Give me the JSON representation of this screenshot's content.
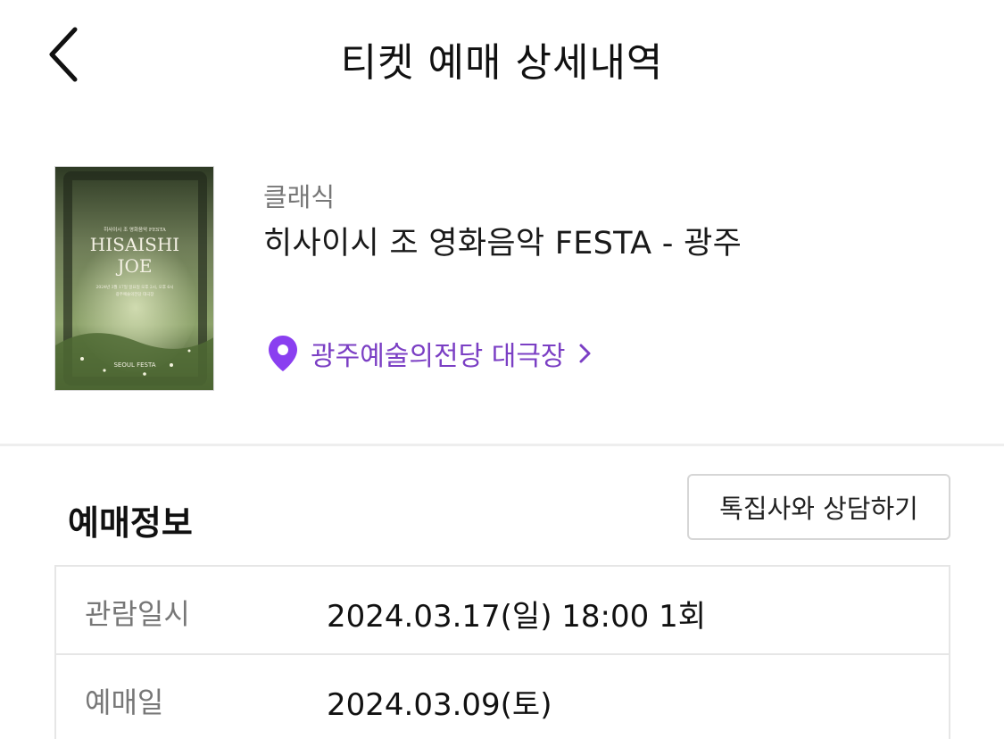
{
  "header": {
    "title": "티켓 예매 상세내역",
    "back_icon": "chevron-left-icon"
  },
  "event": {
    "poster": {
      "small_text": "히사이시 조 영화음악 FESTA",
      "name_line1": "HISAISHI",
      "name_line2": "JOE",
      "detail_line1": "2024년 3월 17일 일요일 오후 2시, 오후 6시",
      "detail_line2": "광주예술의전당 대극장",
      "brand": "SEOUL FESTA"
    },
    "genre": "클래식",
    "title": "히사이시 조 영화음악 FESTA - 광주",
    "venue": {
      "name": "광주예술의전당 대극장",
      "icon": "location-pin-icon",
      "chevron_icon": "chevron-right-icon",
      "color": "#7b3fc4"
    }
  },
  "booking_info": {
    "section_title": "예매정보",
    "consult_button": "톡집사와 상담하기",
    "rows": [
      {
        "label": "관람일시",
        "value": "2024.03.17(일) 18:00 1회"
      },
      {
        "label": "예매일",
        "value": "2024.03.09(토)"
      }
    ]
  }
}
